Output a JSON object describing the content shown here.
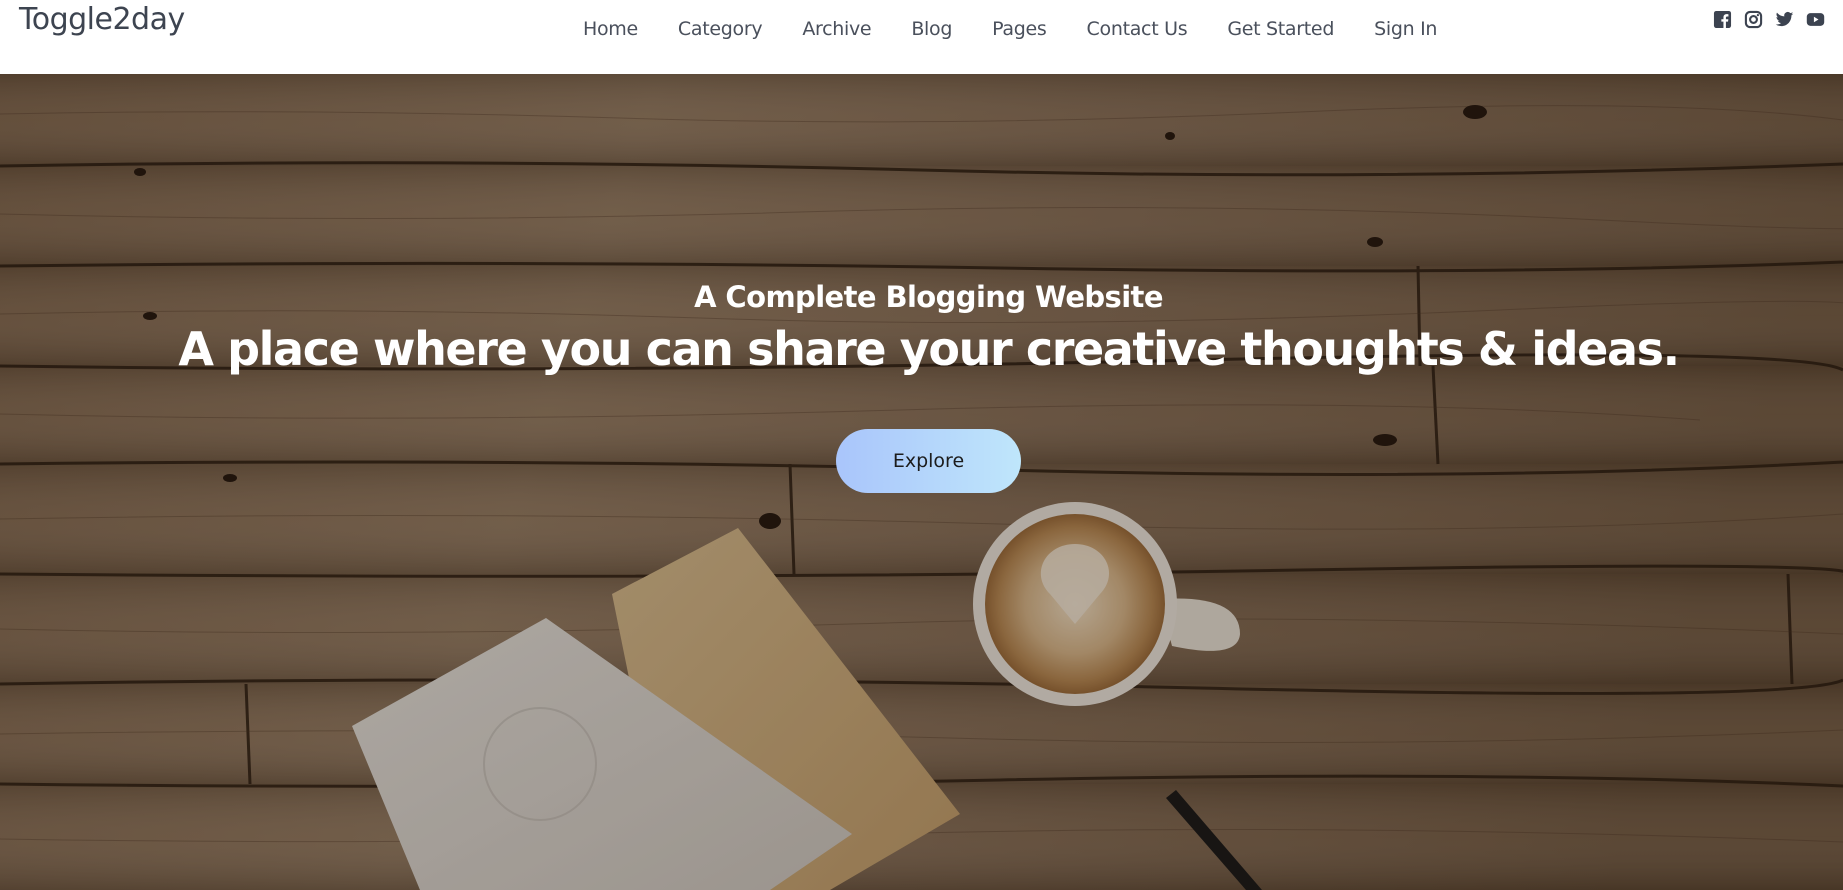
{
  "header": {
    "logo": "Toggle2day",
    "nav": [
      {
        "label": "Home"
      },
      {
        "label": "Category"
      },
      {
        "label": "Archive"
      },
      {
        "label": "Blog"
      },
      {
        "label": "Pages"
      },
      {
        "label": "Contact Us"
      },
      {
        "label": "Get Started"
      },
      {
        "label": "Sign In"
      }
    ],
    "social_icons": [
      "facebook-icon",
      "instagram-icon",
      "twitter-icon",
      "youtube-icon"
    ]
  },
  "hero": {
    "subtitle": "A Complete Blogging Website",
    "title": "A place where you can share your creative thoughts & ideas.",
    "button_label": "Explore"
  },
  "colors": {
    "logo_text": "#3d4450",
    "nav_text": "#4a505c",
    "icon_color": "#3c4350",
    "hero_text": "#ffffff",
    "button_gradient_start": "#a9c5fb",
    "button_gradient_end": "#bfe6fb"
  }
}
